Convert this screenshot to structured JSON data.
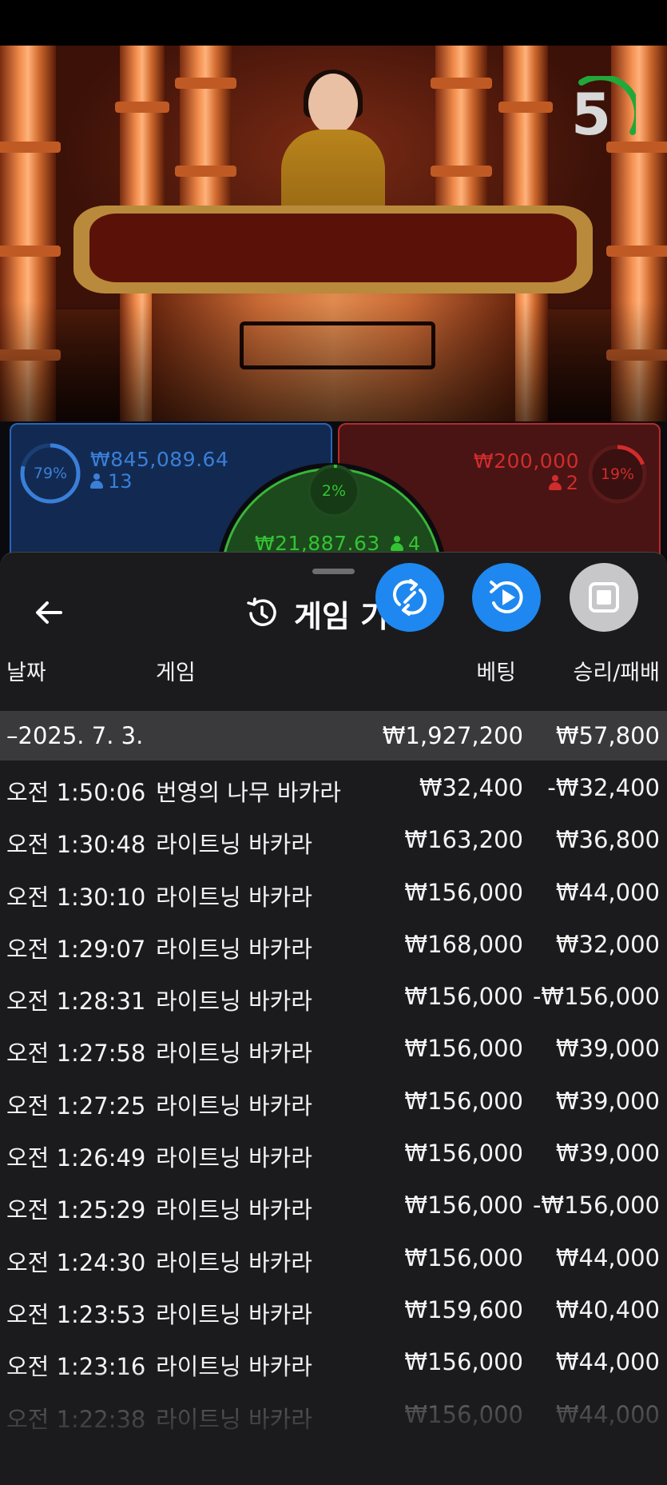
{
  "video": {
    "countdown": "5"
  },
  "betting": {
    "player": {
      "percent": "79%",
      "amount": "₩845,089.64",
      "players": "13",
      "color": "#3a7fd8"
    },
    "banker": {
      "percent": "19%",
      "amount": "₩200,000",
      "players": "2",
      "color": "#d12c2c"
    },
    "tie": {
      "percent": "2%",
      "amount": "₩21,887.63",
      "players": "4",
      "color": "#34c334"
    }
  },
  "sheet": {
    "title": "게임 기록",
    "columns": {
      "date": "날짜",
      "game": "게임",
      "bet": "베팅",
      "result": "승리/패배"
    },
    "summary": {
      "date": "–2025. 7. 3.",
      "bet": "₩1,927,200",
      "result": "₩57,800"
    },
    "rows": [
      {
        "time": "오전 1:50:06",
        "game": "번영의 나무 바카라",
        "bet": "₩32,400",
        "result": "-₩32,400"
      },
      {
        "time": "오전 1:30:48",
        "game": "라이트닝 바카라",
        "bet": "₩163,200",
        "result": "₩36,800"
      },
      {
        "time": "오전 1:30:10",
        "game": "라이트닝 바카라",
        "bet": "₩156,000",
        "result": "₩44,000"
      },
      {
        "time": "오전 1:29:07",
        "game": "라이트닝 바카라",
        "bet": "₩168,000",
        "result": "₩32,000"
      },
      {
        "time": "오전 1:28:31",
        "game": "라이트닝 바카라",
        "bet": "₩156,000",
        "result": "-₩156,000"
      },
      {
        "time": "오전 1:27:58",
        "game": "라이트닝 바카라",
        "bet": "₩156,000",
        "result": "₩39,000"
      },
      {
        "time": "오전 1:27:25",
        "game": "라이트닝 바카라",
        "bet": "₩156,000",
        "result": "₩39,000"
      },
      {
        "time": "오전 1:26:49",
        "game": "라이트닝 바카라",
        "bet": "₩156,000",
        "result": "₩39,000"
      },
      {
        "time": "오전 1:25:29",
        "game": "라이트닝 바카라",
        "bet": "₩156,000",
        "result": "-₩156,000"
      },
      {
        "time": "오전 1:24:30",
        "game": "라이트닝 바카라",
        "bet": "₩156,000",
        "result": "₩44,000"
      },
      {
        "time": "오전 1:23:53",
        "game": "라이트닝 바카라",
        "bet": "₩159,600",
        "result": "₩40,400"
      },
      {
        "time": "오전 1:23:16",
        "game": "라이트닝 바카라",
        "bet": "₩156,000",
        "result": "₩44,000"
      },
      {
        "time": "오전 1:22:38",
        "game": "라이트닝 바카라",
        "bet": "₩156,000",
        "result": "₩44,000"
      }
    ]
  },
  "icons": {
    "back": "arrow-left-icon",
    "history": "history-clock-icon",
    "fab1": "swap-view-icon",
    "fab2": "replay-video-icon",
    "fab3": "stop-square-icon"
  }
}
